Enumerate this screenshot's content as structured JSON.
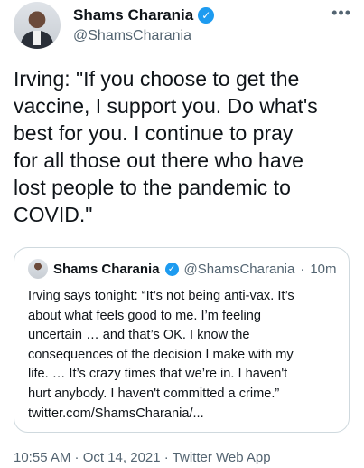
{
  "author": {
    "name": "Shams Charania",
    "handle": "@ShamsCharania",
    "verified_icon": "verified-badge-icon",
    "more_label": "•••"
  },
  "tweet": {
    "text": "Irving: \"If you choose to get the\nvaccine, I support you. Do what's\nbest for you. I continue to pray\nfor all those out there who have\nlost people to the pandemic to\nCOVID.\""
  },
  "quoted_tweet": {
    "name": "Shams Charania",
    "handle": "@ShamsCharania",
    "separator": "·",
    "time": "10m",
    "text": "Irving says tonight: “It’s not being anti-vax. It’s\nabout what feels good to me. I’m feeling\nuncertain … and that’s OK. I know the\nconsequences of the decision I make with my\nlife. … It’s crazy times that we’re in. I haven't\nhurt anybody. I haven't committed a crime.”\ntwitter.com/ShamsCharania/..."
  },
  "footer": {
    "text": "10:55 AM · Oct 14, 2021 · Twitter Web App"
  },
  "colors": {
    "accent": "#1d9bf0",
    "secondary_text": "#536471",
    "border": "#cfd9de"
  }
}
